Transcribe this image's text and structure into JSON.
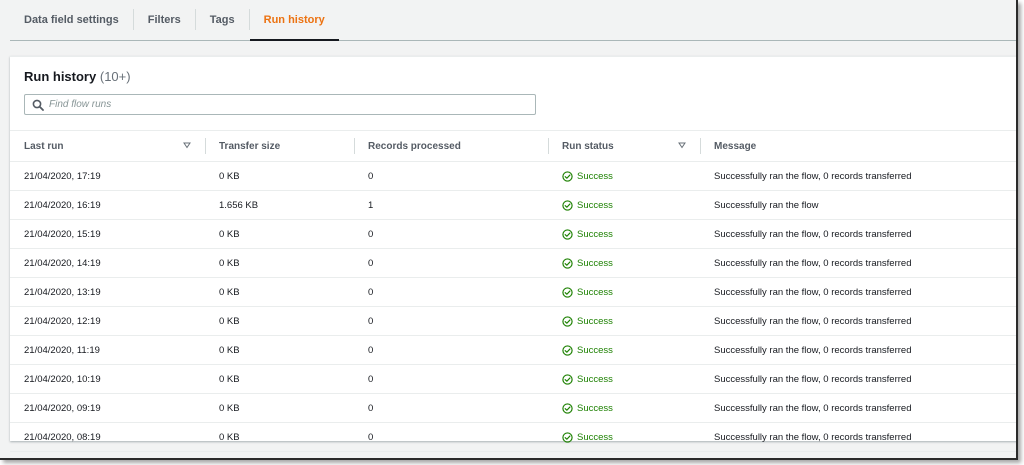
{
  "tabs": [
    {
      "label": "Data field settings",
      "active": false
    },
    {
      "label": "Filters",
      "active": false
    },
    {
      "label": "Tags",
      "active": false
    },
    {
      "label": "Run history",
      "active": true
    }
  ],
  "panel": {
    "title": "Run history",
    "count": "(10+)"
  },
  "search": {
    "placeholder": "Find flow runs"
  },
  "table": {
    "columns": [
      {
        "label": "Last run",
        "sortable": true
      },
      {
        "label": "Transfer size",
        "sortable": false
      },
      {
        "label": "Records processed",
        "sortable": false
      },
      {
        "label": "Run status",
        "sortable": true
      },
      {
        "label": "Message",
        "sortable": false
      }
    ],
    "rows": [
      {
        "last_run": "21/04/2020, 17:19",
        "size": "0 KB",
        "records": "0",
        "status": "Success",
        "message": "Successfully ran the flow, 0 records transferred"
      },
      {
        "last_run": "21/04/2020, 16:19",
        "size": "1.656 KB",
        "records": "1",
        "status": "Success",
        "message": "Successfully ran the flow"
      },
      {
        "last_run": "21/04/2020, 15:19",
        "size": "0 KB",
        "records": "0",
        "status": "Success",
        "message": "Successfully ran the flow, 0 records transferred"
      },
      {
        "last_run": "21/04/2020, 14:19",
        "size": "0 KB",
        "records": "0",
        "status": "Success",
        "message": "Successfully ran the flow, 0 records transferred"
      },
      {
        "last_run": "21/04/2020, 13:19",
        "size": "0 KB",
        "records": "0",
        "status": "Success",
        "message": "Successfully ran the flow, 0 records transferred"
      },
      {
        "last_run": "21/04/2020, 12:19",
        "size": "0 KB",
        "records": "0",
        "status": "Success",
        "message": "Successfully ran the flow, 0 records transferred"
      },
      {
        "last_run": "21/04/2020, 11:19",
        "size": "0 KB",
        "records": "0",
        "status": "Success",
        "message": "Successfully ran the flow, 0 records transferred"
      },
      {
        "last_run": "21/04/2020, 10:19",
        "size": "0 KB",
        "records": "0",
        "status": "Success",
        "message": "Successfully ran the flow, 0 records transferred"
      },
      {
        "last_run": "21/04/2020, 09:19",
        "size": "0 KB",
        "records": "0",
        "status": "Success",
        "message": "Successfully ran the flow, 0 records transferred"
      },
      {
        "last_run": "21/04/2020, 08:19",
        "size": "0 KB",
        "records": "0",
        "status": "Success",
        "message": "Successfully ran the flow, 0 records transferred"
      }
    ]
  },
  "icons": {
    "search": "search-icon",
    "sort": "sort-down-icon",
    "status_success": "check-circle-icon"
  },
  "colors": {
    "active_tab": "#ec7211",
    "success": "#1d8102",
    "text": "#16191f",
    "muted": "#545b64"
  }
}
